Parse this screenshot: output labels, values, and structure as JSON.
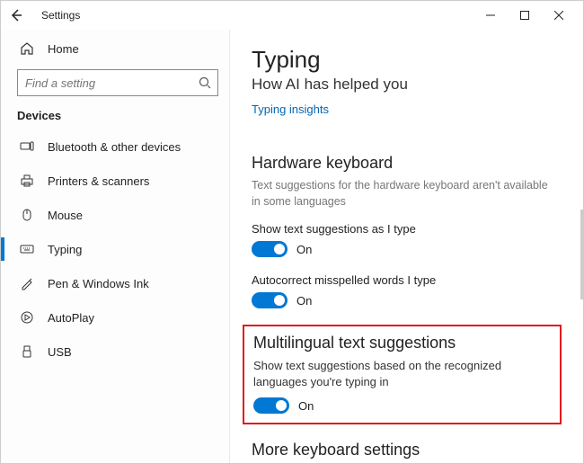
{
  "titlebar": {
    "title": "Settings"
  },
  "sidebar": {
    "home": "Home",
    "search_placeholder": "Find a setting",
    "section": "Devices",
    "items": [
      {
        "label": "Bluetooth & other devices"
      },
      {
        "label": "Printers & scanners"
      },
      {
        "label": "Mouse"
      },
      {
        "label": "Typing"
      },
      {
        "label": "Pen & Windows Ink"
      },
      {
        "label": "AutoPlay"
      },
      {
        "label": "USB"
      }
    ]
  },
  "page": {
    "title": "Typing",
    "subtitle": "How AI has helped you",
    "link": "Typing insights",
    "hw": {
      "heading": "Hardware keyboard",
      "desc": "Text suggestions for the hardware keyboard aren't available in some languages",
      "s1_label": "Show text suggestions as I type",
      "s1_state": "On",
      "s2_label": "Autocorrect misspelled words I type",
      "s2_state": "On"
    },
    "ml": {
      "heading": "Multilingual text suggestions",
      "desc": "Show text suggestions based on the recognized languages you're typing in",
      "state": "On"
    },
    "more_heading": "More keyboard settings"
  }
}
